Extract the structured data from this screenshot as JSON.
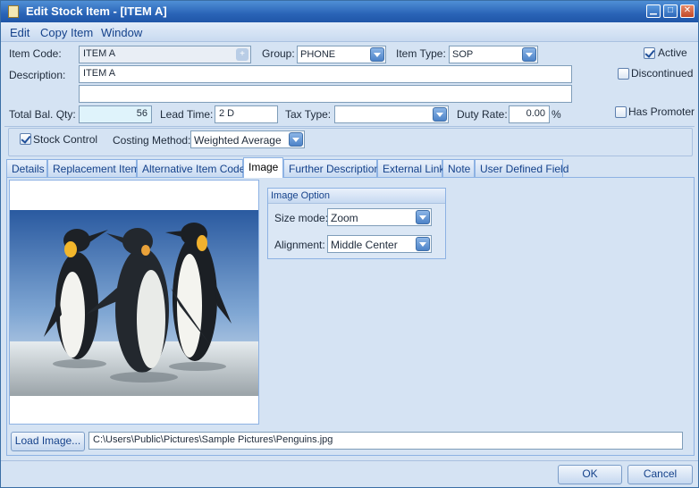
{
  "window": {
    "title": "Edit Stock Item - [ITEM A]"
  },
  "menu": [
    "Edit",
    "Copy Item",
    "Window"
  ],
  "form": {
    "item_code_label": "Item Code:",
    "item_code": "ITEM A",
    "group_label": "Group:",
    "group": "PHONE",
    "item_type_label": "Item Type:",
    "item_type": "SOP",
    "active_label": "Active",
    "active": true,
    "description_label": "Description:",
    "description": "ITEM A",
    "description2": "",
    "discontinued_label": "Discontinued",
    "discontinued": false,
    "total_bal_qty_label": "Total Bal. Qty:",
    "total_bal_qty": "56",
    "lead_time_label": "Lead Time:",
    "lead_time": "2 D",
    "tax_type_label": "Tax Type:",
    "tax_type": "",
    "duty_rate_label": "Duty Rate:",
    "duty_rate": "0.00",
    "duty_rate_unit": "%",
    "has_promoter_label": "Has Promoter",
    "has_promoter": false,
    "stock_control_label": "Stock Control",
    "stock_control": true,
    "costing_method_label": "Costing Method:",
    "costing_method": "Weighted Average"
  },
  "tabs": [
    {
      "label": "Details"
    },
    {
      "label": "Replacement Item"
    },
    {
      "label": "Alternative Item Code"
    },
    {
      "label": "Image",
      "active": true
    },
    {
      "label": "Further Description"
    },
    {
      "label": "External Link"
    },
    {
      "label": "Note"
    },
    {
      "label": "User Defined Field"
    }
  ],
  "image_tab": {
    "image_option_title": "Image Option",
    "size_mode_label": "Size mode:",
    "size_mode": "Zoom",
    "alignment_label": "Alignment:",
    "alignment": "Middle Center",
    "load_image_label": "Load Image...",
    "image_path": "C:\\Users\\Public\\Pictures\\Sample Pictures\\Penguins.jpg"
  },
  "buttons": {
    "ok": "OK",
    "cancel": "Cancel"
  },
  "colors": {
    "title_bar": "#2a64b7",
    "panel": "#d5e3f3",
    "accent": "#15428b",
    "tab_border": "#8db2e3"
  }
}
